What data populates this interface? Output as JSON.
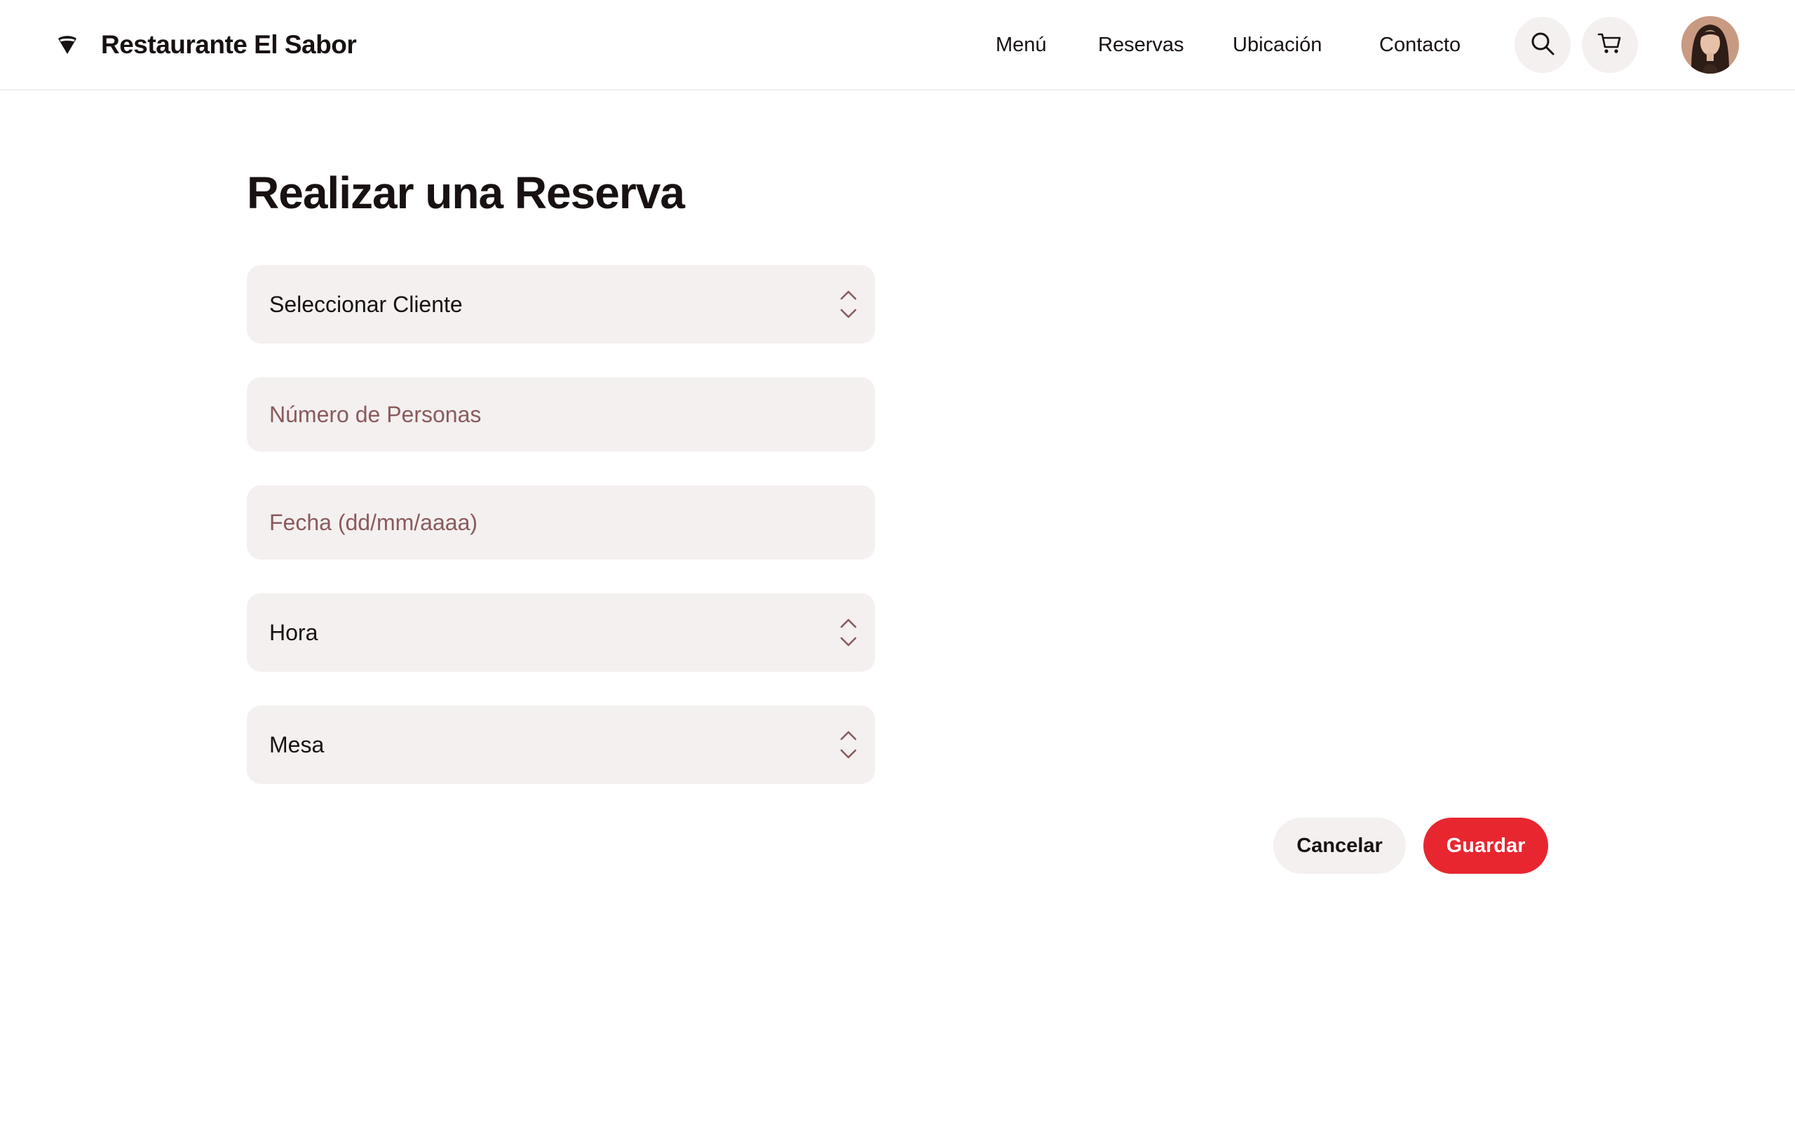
{
  "brand": {
    "name": "Restaurante El Sabor",
    "logo_icon": "diamond-logo-icon"
  },
  "nav": {
    "items": [
      {
        "label": "Menú"
      },
      {
        "label": "Reservas"
      },
      {
        "label": "Ubicación"
      },
      {
        "label": "Contacto"
      }
    ],
    "search_icon": "search-icon",
    "cart_icon": "shopping-cart-icon"
  },
  "main": {
    "title": "Realizar una Reserva"
  },
  "form": {
    "client": {
      "value": "Seleccionar Cliente"
    },
    "people": {
      "placeholder": "Número de Personas"
    },
    "date": {
      "placeholder": "Fecha (dd/mm/aaaa)"
    },
    "time": {
      "value": "Hora"
    },
    "table": {
      "value": "Mesa"
    }
  },
  "actions": {
    "cancel_label": "Cancelar",
    "save_label": "Guardar"
  },
  "colors": {
    "accent": "#e82630",
    "field_bg": "#f4f0f0",
    "placeholder": "#8a5a5c",
    "text": "#181111"
  }
}
